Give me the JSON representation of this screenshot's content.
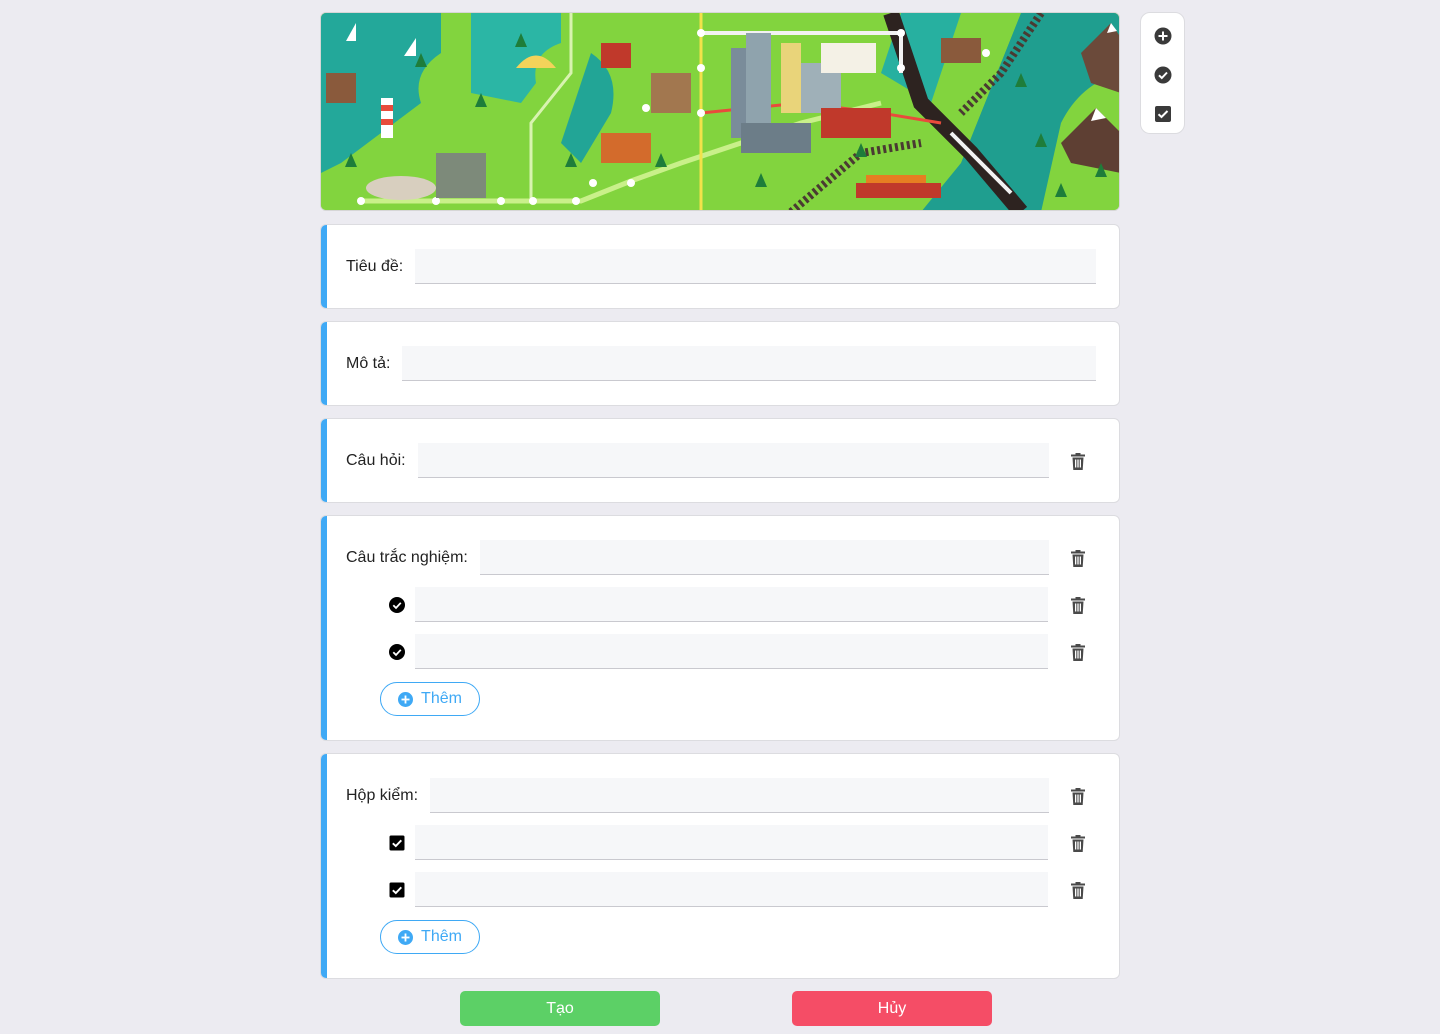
{
  "banner": {
    "alt": "city map illustration"
  },
  "toolbar": {
    "items": [
      {
        "name": "add-question",
        "icon": "plus-circle-icon"
      },
      {
        "name": "add-multiple-choice",
        "icon": "check-circle-icon"
      },
      {
        "name": "add-checkbox",
        "icon": "check-square-icon"
      }
    ]
  },
  "form": {
    "title_label": "Tiêu đề:",
    "title_value": "",
    "description_label": "Mô tả:",
    "description_value": "",
    "question_label": "Câu hỏi:",
    "question_value": "",
    "multiple_choice": {
      "label": "Câu trắc nghiệm:",
      "value": "",
      "options": [
        "",
        ""
      ],
      "add_label": "Thêm"
    },
    "checkbox": {
      "label": "Hộp kiểm:",
      "value": "",
      "options": [
        "",
        ""
      ],
      "add_label": "Thêm"
    }
  },
  "actions": {
    "create_label": "Tạo",
    "cancel_label": "Hủy"
  },
  "colors": {
    "accent": "#3fa9f5",
    "create": "#5cd066",
    "cancel": "#f54d66",
    "background": "#ecebf1"
  }
}
